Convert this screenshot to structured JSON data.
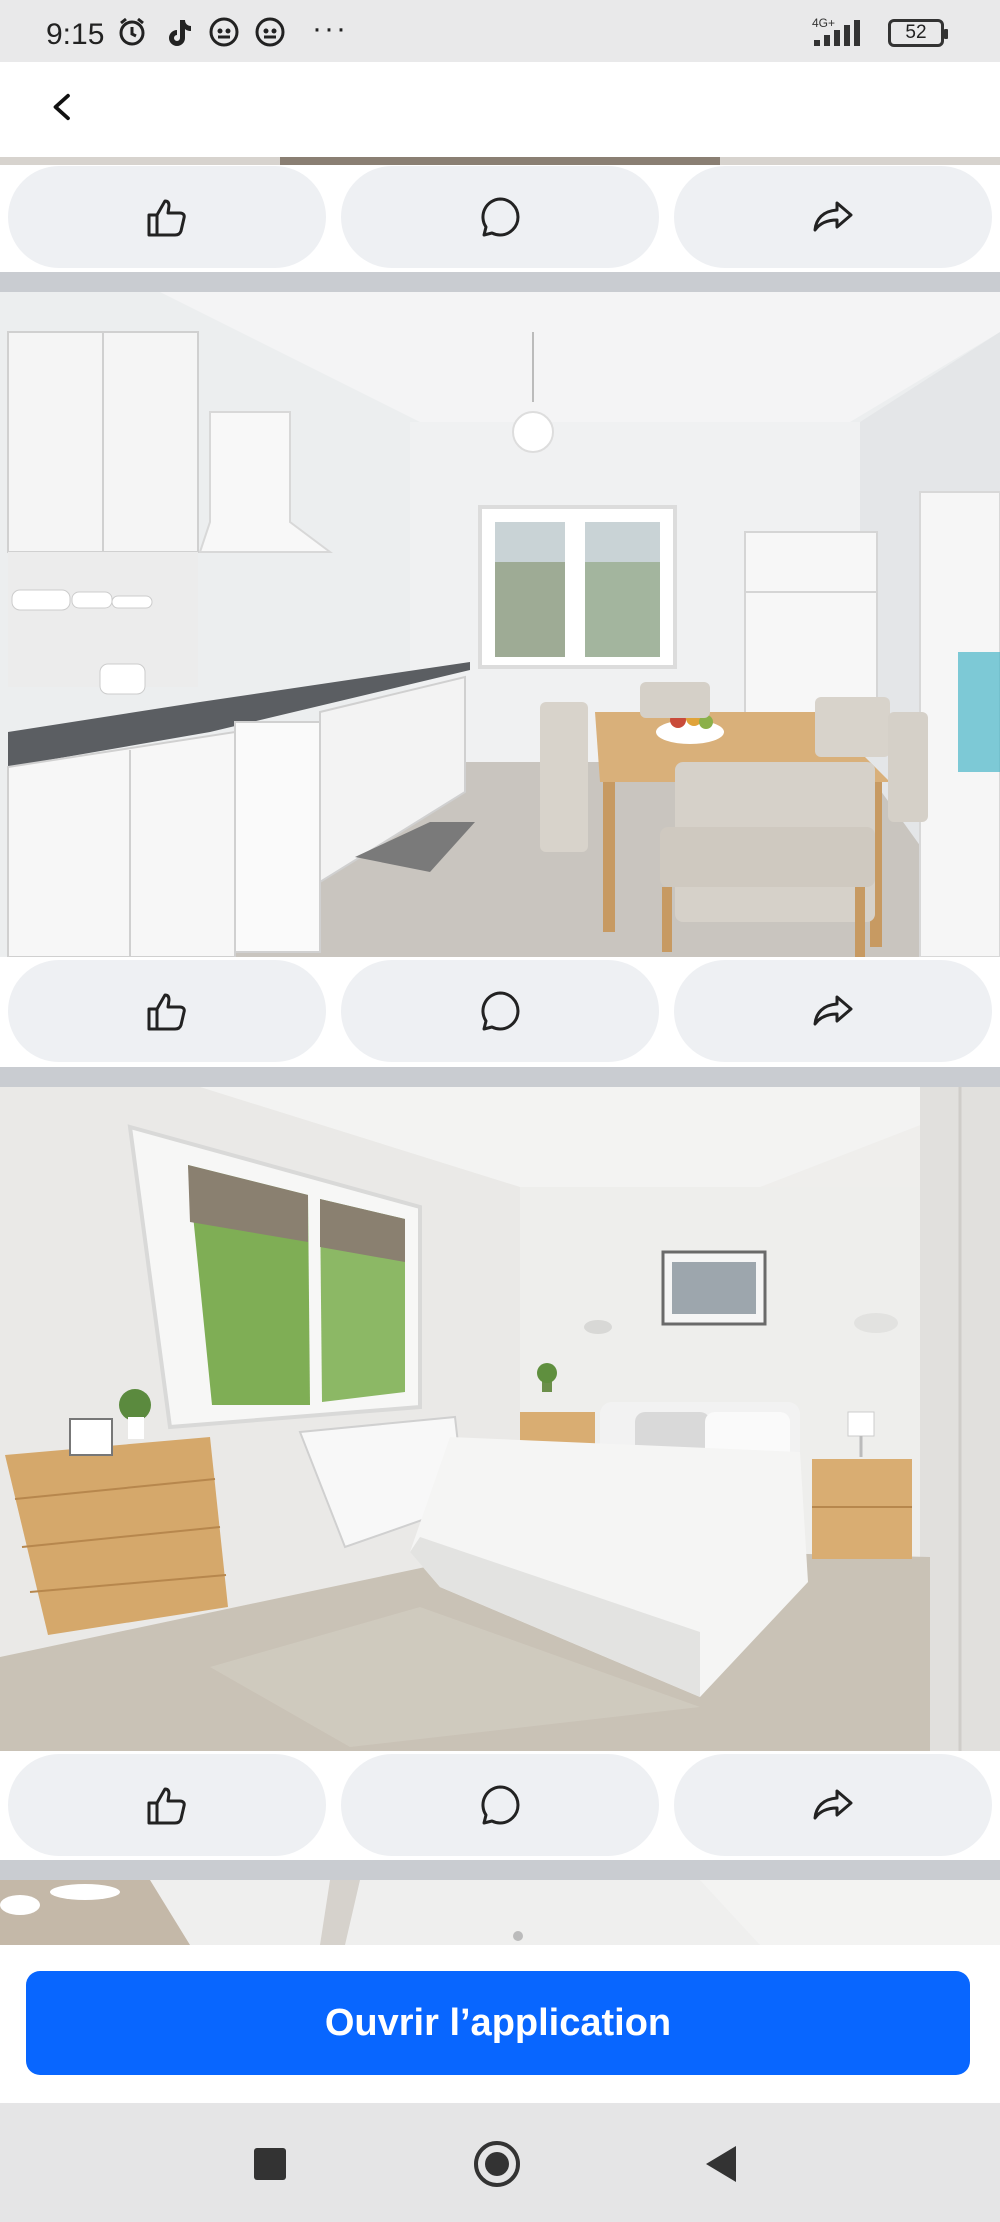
{
  "status_bar": {
    "time": "9:15",
    "network": "4G+",
    "battery": "52",
    "app_icons": [
      "alarm-icon",
      "tiktok-icon",
      "app-icon",
      "app-icon"
    ],
    "more": "···"
  },
  "top_bar": {
    "back_icon": "chevron-left-icon"
  },
  "posts": [
    {
      "photo": "partial-photo-top",
      "actions": [
        "like-icon",
        "comment-icon",
        "share-icon"
      ]
    },
    {
      "photo": "kitchen-dining-room-photo",
      "actions": [
        "like-icon",
        "comment-icon",
        "share-icon"
      ]
    },
    {
      "photo": "bedroom-photo",
      "actions": [
        "like-icon",
        "comment-icon",
        "share-icon"
      ]
    },
    {
      "photo": "partial-photo-bottom"
    }
  ],
  "open_app": {
    "label": "Ouvrir l’application",
    "color": "#0866ff"
  },
  "nav_bar": {
    "buttons": [
      "recents-square-icon",
      "home-circle-icon",
      "back-triangle-icon"
    ]
  }
}
